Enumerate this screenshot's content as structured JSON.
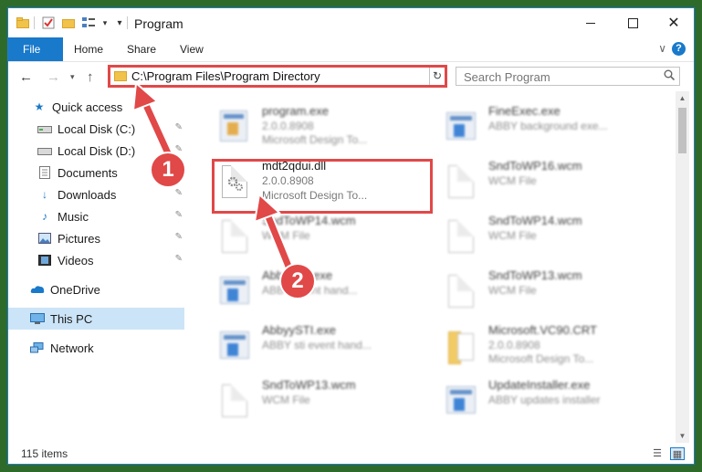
{
  "window": {
    "title": "Program",
    "minimize_icon": "minimize-icon",
    "maximize_icon": "maximize-icon",
    "close_icon": "close-icon"
  },
  "ribbon": {
    "tabs": [
      "File",
      "Home",
      "Share",
      "View"
    ],
    "expand_glyph": "∨",
    "help_glyph": "?"
  },
  "address_bar": {
    "path": "C:\\Program Files\\Program Directory",
    "dropdown_glyph": "∨",
    "refresh_glyph": "↻"
  },
  "search": {
    "placeholder": "Search Program",
    "icon": "search-icon"
  },
  "sidebar": {
    "items": [
      {
        "label": "Quick access",
        "icon": "star-icon",
        "pinned": false
      },
      {
        "label": "Local Disk (C:)",
        "icon": "drive-icon",
        "pinned": true
      },
      {
        "label": "Local Disk (D:)",
        "icon": "drive-icon",
        "pinned": true
      },
      {
        "label": "Documents",
        "icon": "documents-icon",
        "pinned": true
      },
      {
        "label": "Downloads",
        "icon": "download-icon",
        "pinned": true
      },
      {
        "label": "Music",
        "icon": "music-icon",
        "pinned": true
      },
      {
        "label": "Pictures",
        "icon": "pictures-icon",
        "pinned": true
      },
      {
        "label": "Videos",
        "icon": "videos-icon",
        "pinned": true
      },
      {
        "label": "OneDrive",
        "icon": "cloud-icon",
        "pinned": false
      },
      {
        "label": "This PC",
        "icon": "computer-icon",
        "pinned": false,
        "selected": true
      },
      {
        "label": "Network",
        "icon": "network-icon",
        "pinned": false
      }
    ],
    "pin_glyph": "📌"
  },
  "files": [
    {
      "name": "program.exe",
      "line1": "2.0.0.8908",
      "line2": "Microsoft Design To...",
      "icon": "exe-icon"
    },
    {
      "name": "FineExec.exe",
      "line1": "ABBY background exe...",
      "line2": "",
      "icon": "app-icon"
    },
    {
      "name": "mdt2qdui.dll",
      "line1": "2.0.0.8908",
      "line2": "Microsoft Design To...",
      "icon": "dll-gear-icon",
      "highlighted": true
    },
    {
      "name": "SndToWP16.wcm",
      "line1": "WCM File",
      "line2": "",
      "icon": "file-icon"
    },
    {
      "name": "SndToWP14.wcm",
      "line1": "WCM File",
      "line2": "",
      "icon": "file-icon"
    },
    {
      "name": "SndToWP14.wcm",
      "line1": "WCM File",
      "line2": "",
      "icon": "file-icon"
    },
    {
      "name": "AbbyyHP.exe",
      "line1": "ABBY event hand...",
      "line2": "",
      "icon": "app-icon"
    },
    {
      "name": "SndToWP13.wcm",
      "line1": "WCM File",
      "line2": "",
      "icon": "file-icon"
    },
    {
      "name": "AbbyySTI.exe",
      "line1": "ABBY sti event hand...",
      "line2": "",
      "icon": "app-icon"
    },
    {
      "name": "Microsoft.VC90.CRT",
      "line1": "2.0.0.8908",
      "line2": "Microsoft Design To...",
      "icon": "folder-icon"
    },
    {
      "name": "SndToWP13.wcm",
      "line1": "WCM File",
      "line2": "",
      "icon": "file-icon"
    },
    {
      "name": "UpdateInstaller.exe",
      "line1": "ABBY updates installer",
      "line2": "",
      "icon": "app-icon"
    }
  ],
  "annotations": {
    "step1": "1",
    "step2": "2",
    "accent_color": "#e14848"
  },
  "status_bar": {
    "item_count": "115 items"
  },
  "colors": {
    "accent": "#1979ca",
    "selection": "#cce4f7"
  }
}
